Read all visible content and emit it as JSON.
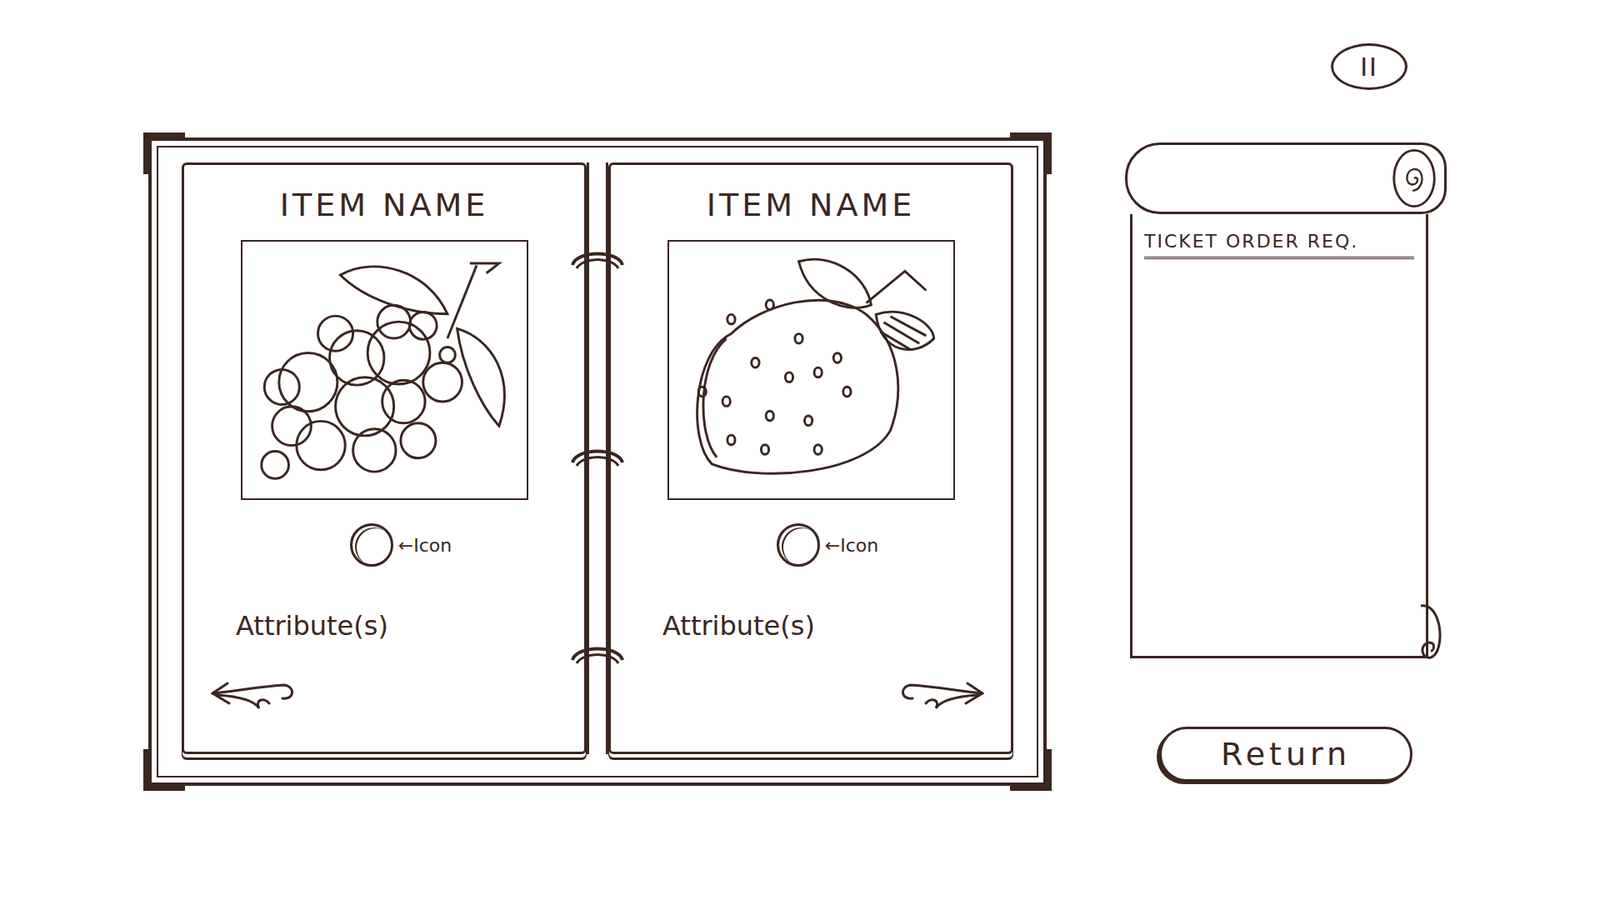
{
  "pause_button": {
    "label": "II"
  },
  "book": {
    "pages": [
      {
        "title": "ITEM NAME",
        "kind": "grapes",
        "icon_note": "←Icon",
        "attributes": "Attribute(s)"
      },
      {
        "title": "ITEM NAME",
        "kind": "strawberry",
        "icon_note": "←Icon",
        "attributes": "Attribute(s)"
      }
    ]
  },
  "order_scroll": {
    "title": "TICKET ORDER REQ."
  },
  "return_button": {
    "label": "Return"
  }
}
